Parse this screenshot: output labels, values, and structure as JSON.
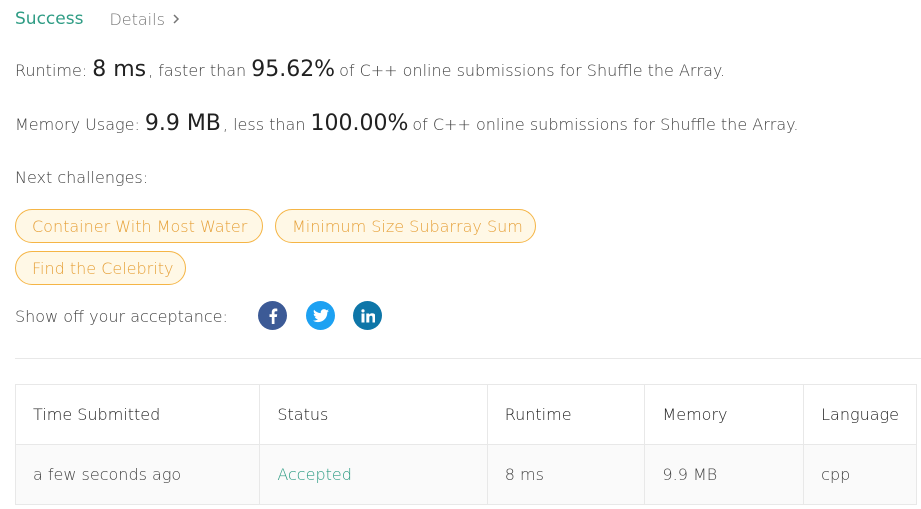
{
  "header": {
    "status": "Success",
    "details_label": "Details"
  },
  "runtime": {
    "label": "Runtime:",
    "value": "8 ms",
    "comparison": ", faster than",
    "percent": "95.62%",
    "suffix": "of C++ online submissions for Shuffle the Array."
  },
  "memory": {
    "label": "Memory Usage:",
    "value": "9.9 MB",
    "comparison": ", less than",
    "percent": "100.00%",
    "suffix": "of C++ online submissions for Shuffle the Array."
  },
  "next": {
    "label": "Next challenges:",
    "challenges": [
      "Container With Most Water",
      "Minimum Size Subarray Sum",
      "Find the Celebrity"
    ]
  },
  "share": {
    "label": "Show off your acceptance:",
    "icons": [
      "facebook-icon",
      "twitter-icon",
      "linkedin-icon"
    ],
    "colors": {
      "facebook": "#3c5a96",
      "twitter": "#1da1f2",
      "linkedin": "#0e76a8"
    }
  },
  "table": {
    "headers": [
      "Time Submitted",
      "Status",
      "Runtime",
      "Memory",
      "Language"
    ],
    "rows": [
      [
        "a few seconds ago",
        "Accepted",
        "8 ms",
        "9.9 MB",
        "cpp"
      ]
    ]
  },
  "colors": {
    "accent": "#2e9c84",
    "pill_border": "#f5b546",
    "pill_text": "#e6a13a"
  }
}
